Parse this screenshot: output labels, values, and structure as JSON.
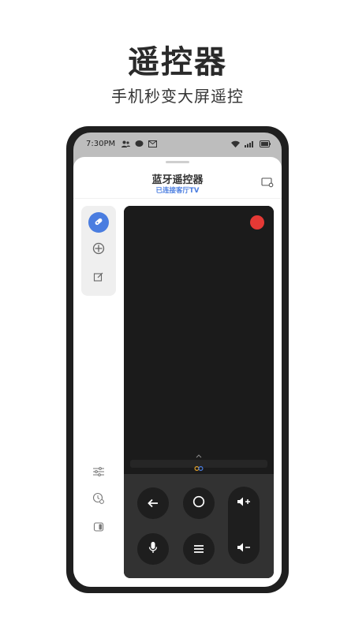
{
  "header": {
    "title": "遥控器",
    "subtitle": "手机秒变大屏遥控"
  },
  "status_bar": {
    "time": "7:30PM",
    "icons": [
      "contacts-icon",
      "chat-bubble-icon",
      "mail-icon",
      "wifi-icon",
      "signal-icon",
      "battery-icon"
    ]
  },
  "sheet": {
    "title": "蓝牙遥控器",
    "subtitle": "已连接客厅TV"
  },
  "side_menu": {
    "items": [
      "touchpad-icon",
      "dpad-icon",
      "edit-icon"
    ],
    "active_index": 0
  },
  "bottom_tools": [
    "sliders-icon",
    "clock-settings-icon",
    "toggle-panel-icon"
  ],
  "remote": {
    "buttons": [
      "back-icon",
      "home-icon",
      "volume-up-icon",
      "mic-icon",
      "menu-icon",
      "volume-down-icon"
    ]
  },
  "colors": {
    "accent": "#4a7de0",
    "record": "#e53935",
    "remote_dark": "#1b1b1b",
    "control_bg": "#323232"
  }
}
